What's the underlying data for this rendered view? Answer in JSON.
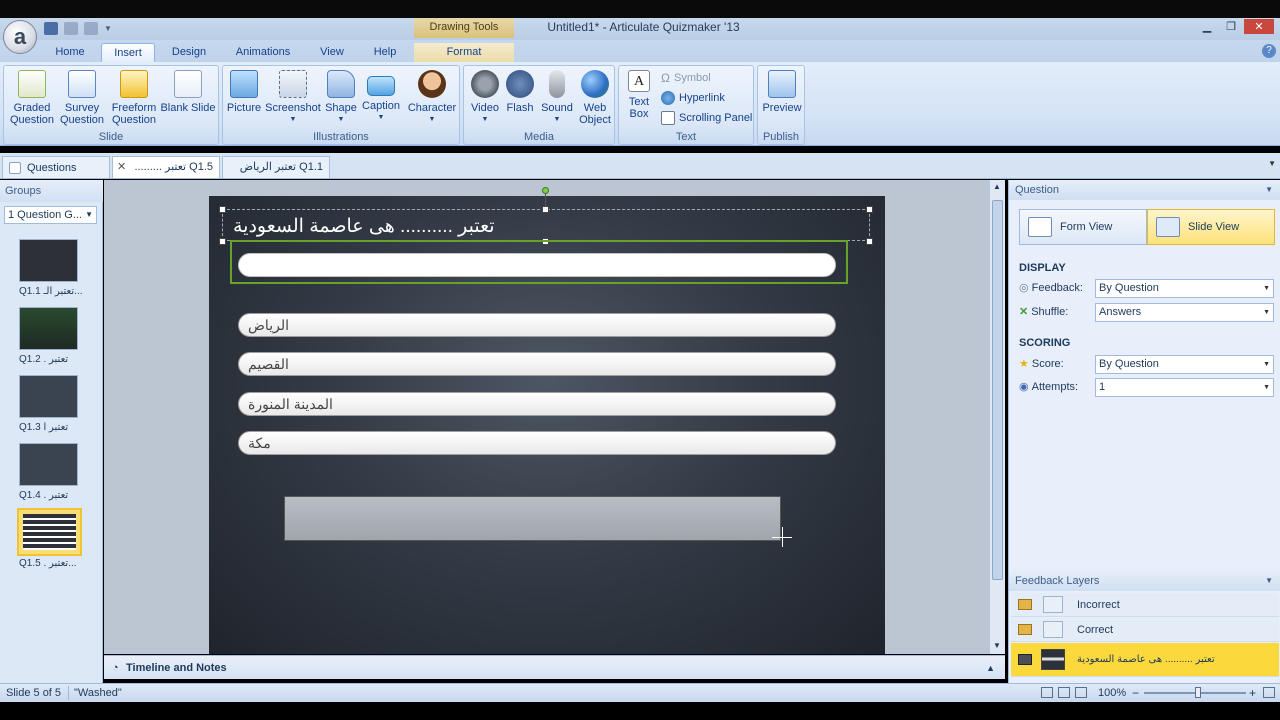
{
  "window": {
    "title": "Untitled1* - Articulate Quizmaker '13",
    "context_tab_group": "Drawing Tools",
    "app_logo": "a"
  },
  "ribbon_tabs": [
    "Home",
    "Insert",
    "Design",
    "Animations",
    "View",
    "Help",
    "Format"
  ],
  "ribbon": {
    "slide_group": {
      "label": "Slide",
      "buttons": [
        {
          "line1": "Graded",
          "line2": "Question",
          "icon": "graded-question-icon"
        },
        {
          "line1": "Survey",
          "line2": "Question",
          "icon": "survey-question-icon"
        },
        {
          "line1": "Freeform",
          "line2": "Question",
          "icon": "freeform-question-icon"
        },
        {
          "line1": "Blank Slide",
          "line2": "",
          "icon": "blank-slide-icon"
        }
      ]
    },
    "illustrations_group": {
      "label": "Illustrations",
      "buttons": [
        "Picture",
        "Screenshot",
        "Shape",
        "Caption",
        "Character"
      ]
    },
    "media_group": {
      "label": "Media",
      "buttons": [
        {
          "line1": "Video",
          "line2": ""
        },
        {
          "line1": "Flash",
          "line2": ""
        },
        {
          "line1": "Sound",
          "line2": ""
        },
        {
          "line1": "Web",
          "line2": "Object"
        }
      ]
    },
    "text_group": {
      "label": "Text",
      "textbox_line1": "Text",
      "textbox_line2": "Box",
      "symbol": "Symbol",
      "hyperlink": "Hyperlink",
      "scrolling_panel": "Scrolling Panel"
    },
    "publish_group": {
      "label": "Publish",
      "preview": "Preview"
    }
  },
  "doc_tabs": {
    "questions": "Questions",
    "tab1": "Q1.5 تعتبر .........",
    "tab2": "Q1.1 تعتبر الرياض ه..."
  },
  "left_panel": {
    "header": "Groups",
    "group_select": "1 Question G...",
    "thumbnails": [
      {
        "label": "Q1.1 تعتبر الـ..."
      },
      {
        "label": "Q1.2 . تعتبر"
      },
      {
        "label": "Q1.3 تعتبر ا"
      },
      {
        "label": "Q1.4 . تعتبر"
      },
      {
        "label": "Q1.5 . تعتبر..."
      }
    ]
  },
  "slide": {
    "question_title": "تعتبر .......... هى عاصمة السعودية",
    "answers": [
      "الرياض",
      "القصيم",
      "المدينة المنورة",
      "مكة"
    ]
  },
  "timeline": {
    "label": "Timeline and Notes"
  },
  "right_panel": {
    "header": "Question",
    "form_view": "Form View",
    "slide_view": "Slide View",
    "display_title": "DISPLAY",
    "feedback_label": "Feedback:",
    "feedback_value": "By Question",
    "shuffle_label": "Shuffle:",
    "shuffle_value": "Answers",
    "scoring_title": "SCORING",
    "score_label": "Score:",
    "score_value": "By Question",
    "attempts_label": "Attempts:",
    "attempts_value": "1",
    "layers_header": "Feedback Layers",
    "layers": [
      {
        "name": "Incorrect"
      },
      {
        "name": "Correct"
      },
      {
        "name": "تعتبر .......... هى عاصمة السعودية"
      }
    ]
  },
  "statusbar": {
    "slide_info": "Slide 5 of 5",
    "theme": "\"Washed\"",
    "zoom": "100%"
  },
  "colors": {
    "ribbon_bg": "#d3e2f5",
    "selected_layer": "#fbd83c",
    "selection_green": "#6aa12c",
    "slide_bg": "#343b46"
  }
}
